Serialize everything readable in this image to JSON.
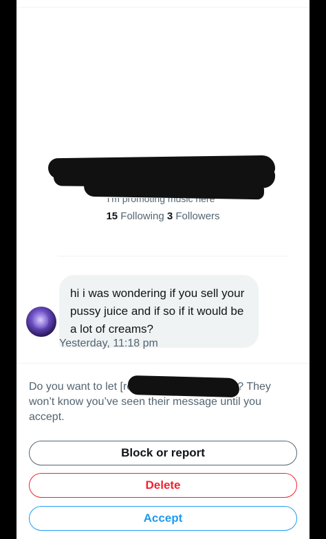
{
  "profile": {
    "bio_visible_fragment": "I'm promoting music here",
    "following_count": "15",
    "following_label": "Following",
    "followers_count": "3",
    "followers_label": "Followers"
  },
  "message": {
    "text": "hi i was wondering if you sell your pussy juice and if so if it would be a lot of creams?",
    "timestamp": "Yesterday, 11:18 pm"
  },
  "request": {
    "prompt_text": "Do you want to let [redacted] message you? They won’t know you’ve seen their message until you accept.",
    "buttons": {
      "block": "Block or report",
      "delete": "Delete",
      "accept": "Accept"
    }
  },
  "colors": {
    "accent_blue": "#1d9bf0",
    "danger_red": "#f4212e",
    "secondary_text": "#536471",
    "bubble_bg": "#eff3f4"
  }
}
